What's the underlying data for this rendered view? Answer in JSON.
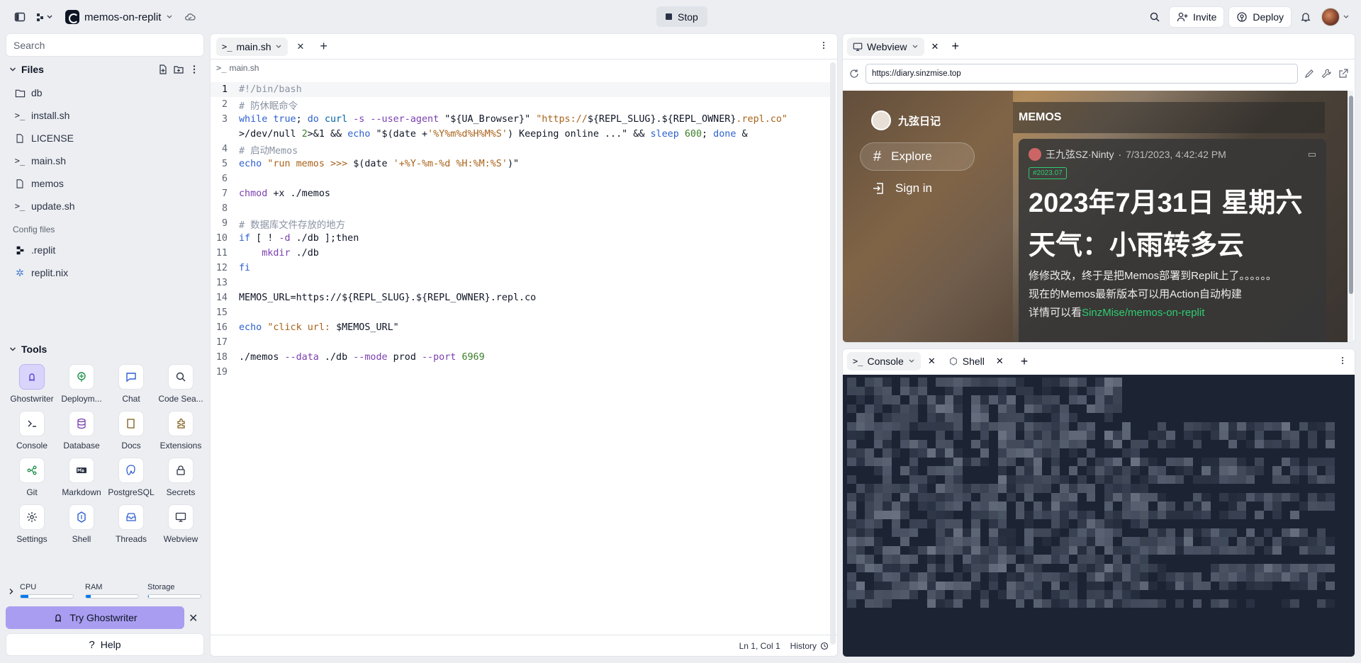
{
  "topbar": {
    "repl_name": "memos-on-replit",
    "stop_label": "Stop",
    "invite_label": "Invite",
    "deploy_label": "Deploy"
  },
  "sidebar": {
    "search_placeholder": "Search",
    "files_title": "Files",
    "files": [
      {
        "name": "db",
        "icon": "folder-icon"
      },
      {
        "name": "install.sh",
        "icon": "terminal-file-icon"
      },
      {
        "name": "LICENSE",
        "icon": "file-icon"
      },
      {
        "name": "main.sh",
        "icon": "terminal-file-icon"
      },
      {
        "name": "memos",
        "icon": "file-icon"
      },
      {
        "name": "update.sh",
        "icon": "terminal-file-icon"
      }
    ],
    "config_label": "Config files",
    "config_files": [
      {
        "name": ".replit",
        "icon": "replit-icon"
      },
      {
        "name": "replit.nix",
        "icon": "nix-icon"
      }
    ],
    "tools_title": "Tools",
    "tools": [
      {
        "label": "Ghostwriter",
        "icon": "ghostwriter-icon",
        "active": true
      },
      {
        "label": "Deploym...",
        "icon": "deployments-icon"
      },
      {
        "label": "Chat",
        "icon": "chat-icon"
      },
      {
        "label": "Code Sea...",
        "icon": "code-search-icon"
      },
      {
        "label": "Console",
        "icon": "console-icon"
      },
      {
        "label": "Database",
        "icon": "database-icon"
      },
      {
        "label": "Docs",
        "icon": "docs-icon"
      },
      {
        "label": "Extensions",
        "icon": "extensions-icon"
      },
      {
        "label": "Git",
        "icon": "git-icon"
      },
      {
        "label": "Markdown",
        "icon": "markdown-icon"
      },
      {
        "label": "PostgreSQL",
        "icon": "postgresql-icon"
      },
      {
        "label": "Secrets",
        "icon": "lock-icon"
      },
      {
        "label": "Settings",
        "icon": "gear-icon"
      },
      {
        "label": "Shell",
        "icon": "shell-icon"
      },
      {
        "label": "Threads",
        "icon": "threads-icon"
      },
      {
        "label": "Webview",
        "icon": "webview-icon"
      }
    ],
    "resources": {
      "cpu_label": "CPU",
      "cpu_level": 0.15,
      "ram_label": "RAM",
      "ram_level": 0.1,
      "storage_label": "Storage",
      "storage_level": 0.02
    },
    "try_label": "Try Ghostwriter",
    "help_label": "Help"
  },
  "editor": {
    "tab_label": "main.sh",
    "breadcrumb": "main.sh",
    "status_pos": "Ln 1, Col 1",
    "history_label": "History",
    "lines": [
      {
        "n": "1",
        "parts": [
          [
            "c",
            "#!/bin/bash"
          ]
        ]
      },
      {
        "n": "2",
        "parts": [
          [
            "c",
            "# 防休眠命令"
          ]
        ]
      },
      {
        "n": "3",
        "parts": [
          [
            "k",
            "while"
          ],
          [
            "p",
            " "
          ],
          [
            "k",
            "true"
          ],
          [
            "p",
            "; "
          ],
          [
            "k",
            "do"
          ],
          [
            "p",
            " "
          ],
          [
            "fn",
            "curl"
          ],
          [
            "p",
            " "
          ],
          [
            "v",
            "-s --user-agent"
          ],
          [
            "p",
            " \"${UA_Browser}\" "
          ],
          [
            "s",
            "\"https://"
          ],
          [
            "p",
            "${REPL_SLUG}.${REPL_OWNER}"
          ],
          [
            "s",
            ".repl.co\""
          ]
        ]
      },
      {
        "n": "",
        "parts": [
          [
            "p",
            ">/dev/null "
          ],
          [
            "n",
            "2"
          ],
          [
            "p",
            ">&1 && "
          ],
          [
            "k",
            "echo"
          ],
          [
            "p",
            " \"$(date +"
          ],
          [
            "s",
            "'%Y%m%d%H%M%S'"
          ],
          [
            "p",
            ") Keeping online ...\" && "
          ],
          [
            "k",
            "sleep"
          ],
          [
            "p",
            " "
          ],
          [
            "n",
            "600"
          ],
          [
            "p",
            "; "
          ],
          [
            "k",
            "done"
          ],
          [
            "p",
            " &"
          ]
        ]
      },
      {
        "n": "4",
        "parts": [
          [
            "c",
            "# 启动Memos"
          ]
        ]
      },
      {
        "n": "5",
        "parts": [
          [
            "k",
            "echo"
          ],
          [
            "p",
            " "
          ],
          [
            "s",
            "\"run memos >>> "
          ],
          [
            "p",
            "$(date "
          ],
          [
            "s",
            "'+%Y-%m-%d %H:%M:%S'"
          ],
          [
            "p",
            ")\""
          ]
        ]
      },
      {
        "n": "6",
        "parts": []
      },
      {
        "n": "7",
        "parts": [
          [
            "v",
            "chmod"
          ],
          [
            "p",
            " +x ./memos"
          ]
        ]
      },
      {
        "n": "8",
        "parts": []
      },
      {
        "n": "9",
        "parts": [
          [
            "c",
            "# 数据库文件存放的地方"
          ]
        ]
      },
      {
        "n": "10",
        "parts": [
          [
            "k",
            "if"
          ],
          [
            "p",
            " [ ! "
          ],
          [
            "v",
            "-d"
          ],
          [
            "p",
            " ./db ];then"
          ]
        ]
      },
      {
        "n": "11",
        "parts": [
          [
            "p",
            "    "
          ],
          [
            "v",
            "mkdir"
          ],
          [
            "p",
            " ./db"
          ]
        ]
      },
      {
        "n": "12",
        "parts": [
          [
            "k",
            "fi"
          ]
        ]
      },
      {
        "n": "13",
        "parts": []
      },
      {
        "n": "14",
        "parts": [
          [
            "p",
            "MEMOS_URL=https://${REPL_SLUG}.${REPL_OWNER}.repl.co"
          ]
        ]
      },
      {
        "n": "15",
        "parts": []
      },
      {
        "n": "16",
        "parts": [
          [
            "k",
            "echo"
          ],
          [
            "p",
            " "
          ],
          [
            "s",
            "\"click url: "
          ],
          [
            "p",
            "$MEMOS_URL\""
          ]
        ]
      },
      {
        "n": "17",
        "parts": []
      },
      {
        "n": "18",
        "parts": [
          [
            "p",
            "./memos "
          ],
          [
            "v",
            "--data"
          ],
          [
            "p",
            " ./db "
          ],
          [
            "v",
            "--mode"
          ],
          [
            "p",
            " prod "
          ],
          [
            "v",
            "--port"
          ],
          [
            "p",
            " "
          ],
          [
            "n",
            "6969"
          ]
        ]
      },
      {
        "n": "19",
        "parts": []
      }
    ]
  },
  "webview": {
    "tab_label": "Webview",
    "url": "https://diary.sinzmise.top",
    "site": {
      "brand": "九弦日记",
      "explore": "Explore",
      "sign_in": "Sign in",
      "header": "MEMOS",
      "author": "王九弦SZ·Ninty",
      "date": "7/31/2023, 4:42:42 PM",
      "tag": "#2023.07",
      "heading": "2023年7月31日 星期六 天气：小雨转多云",
      "p1": "修修改改，终于是把Memos部署到Replit上了。。。。。。",
      "p2": "现在的Memos最新版本可以用Action自动构建",
      "p3_prefix": "详情可以看",
      "p3_link": "SinzMise/memos-on-replit"
    }
  },
  "console": {
    "tab_console": "Console",
    "tab_shell": "Shell"
  }
}
